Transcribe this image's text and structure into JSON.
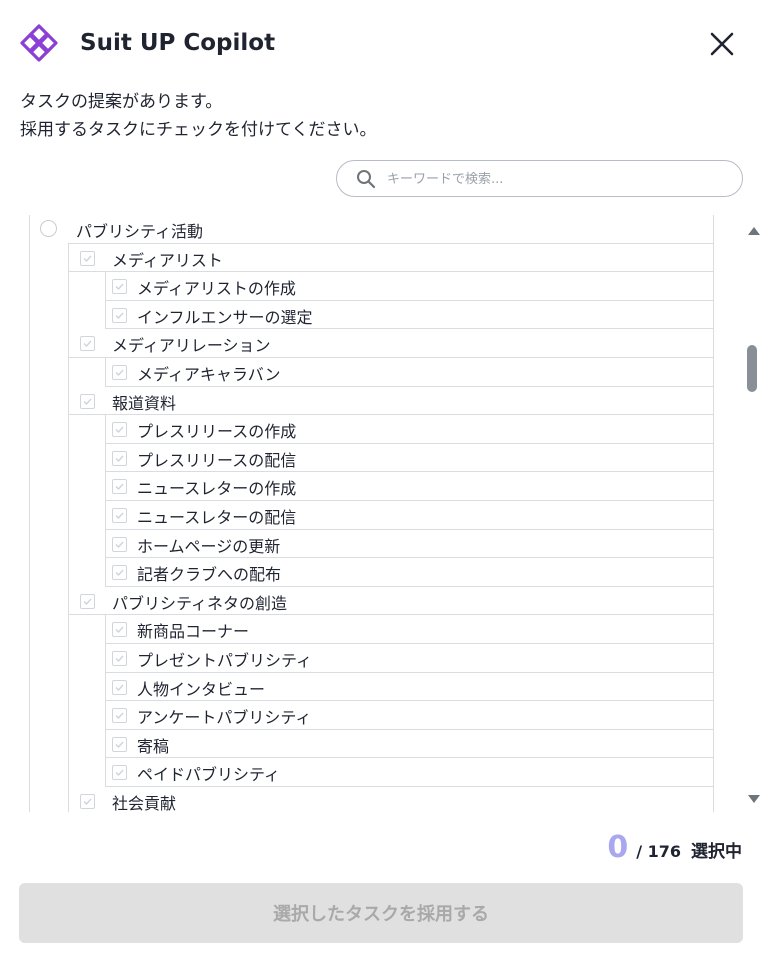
{
  "header": {
    "title": "Suit UP Copilot",
    "brand_color": "#8b3fd6"
  },
  "intro": {
    "line1": "タスクの提案があります。",
    "line2": "採用するタスクにチェックを付けてください。"
  },
  "search": {
    "placeholder": "キーワードで検索..."
  },
  "tree": {
    "root": {
      "label": "パブリシティ活動",
      "checked": false
    },
    "groups": [
      {
        "label": "メディアリスト",
        "items": [
          "メディアリストの作成",
          "インフルエンサーの選定"
        ]
      },
      {
        "label": "メディアリレーション",
        "items": [
          "メディアキャラバン"
        ]
      },
      {
        "label": "報道資料",
        "items": [
          "プレスリリースの作成",
          "プレスリリースの配信",
          "ニュースレターの作成",
          "ニュースレターの配信",
          "ホームページの更新",
          "記者クラブへの配布"
        ]
      },
      {
        "label": "パブリシティネタの創造",
        "items": [
          "新商品コーナー",
          "プレゼントパブリシティ",
          "人物インタビュー",
          "アンケートパブリシティ",
          "寄稿",
          "ペイドパブリシティ"
        ]
      },
      {
        "label": "社会貢献",
        "items": []
      }
    ]
  },
  "footer": {
    "selected_count": "0",
    "total": "/ 176",
    "suffix": "選択中",
    "adopt_button": "選択したタスクを採用する"
  }
}
